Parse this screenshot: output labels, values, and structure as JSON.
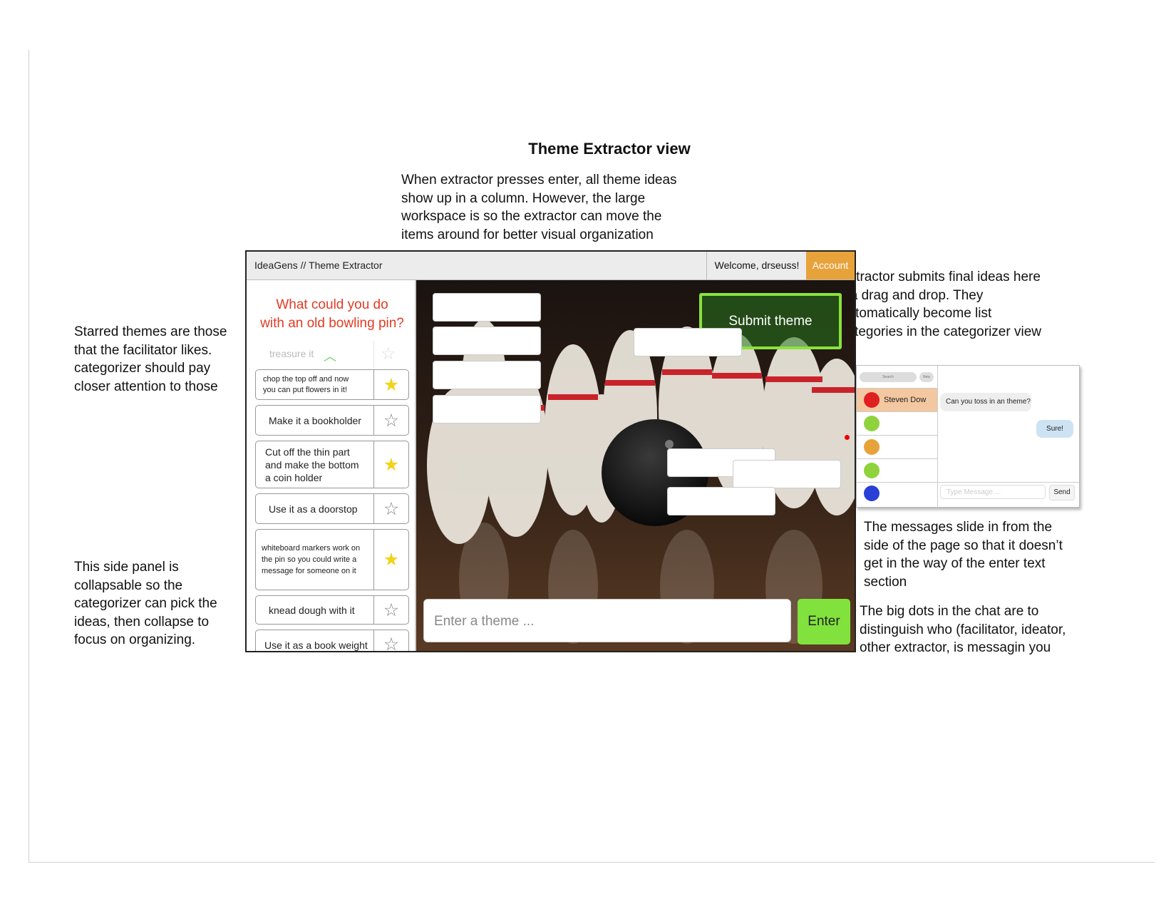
{
  "page": {
    "title": "Theme Extractor view",
    "notes": {
      "top": "When extractor presses enter, all theme ideas\nshow up in a column. However, the large\nworkspace is so the extractor can move the\nitems around for better visual organization",
      "starred": "Starred themes are those\nthat the facilitator likes.\ncategorizer should pay\ncloser attention to those",
      "side_panel": "This side panel is\ncollapsable so the\ncategorizer can pick the\nideas, then collapse to\nfocus on organizing.",
      "submit": "Extractor submits final ideas here\nvia drag and drop. They\nautomatically become list\ncategories in the categorizer view",
      "messages": "The messages slide in from the\nside of the page so that it doesn’t\nget in the way of the enter text\nsection",
      "dots": "The big dots in the chat are to\ndistinguish who (facilitator, ideator,\nother extractor, is messagin you"
    }
  },
  "app": {
    "title": "IdeaGens // Theme Extractor",
    "welcome": "Welcome, drseuss!",
    "account_label": "Account",
    "accent_color": "#e8a23a"
  },
  "sidebar": {
    "prompt": "What could you do\nwith an old bowling pin?",
    "ghost_item": "treasure it",
    "ideas": [
      {
        "text": "chop the top off and now\nyou can put flowers in it!",
        "starred": true
      },
      {
        "text": "Make it a bookholder",
        "starred": false
      },
      {
        "text": "Cut off the thin part\nand make the bottom\na coin holder",
        "starred": true
      },
      {
        "text": "Use it as a doorstop",
        "starred": false
      },
      {
        "text": "whiteboard markers work on\nthe pin so you could write a\nmessage for someone on it",
        "starred": true
      },
      {
        "text": "knead dough with it",
        "starred": false
      },
      {
        "text": "Use it as a book weight",
        "starred": false
      }
    ]
  },
  "workspace": {
    "submit_label": "Submit theme",
    "input_placeholder": "Enter a theme ...",
    "enter_label": "Enter",
    "submit_border_color": "#8ae23c"
  },
  "chat": {
    "search_label": "Search",
    "new_label": "New",
    "contacts": [
      {
        "name": "Steven Dow",
        "color": "#e02020"
      },
      {
        "name": "",
        "color": "#8fd33c"
      },
      {
        "name": "",
        "color": "#e8a23a"
      },
      {
        "name": "",
        "color": "#8fd33c"
      },
      {
        "name": "",
        "color": "#2a3fd6"
      }
    ],
    "incoming_message": "Can you toss in an theme?",
    "outgoing_message": "Sure!",
    "message_placeholder": "Type Message ...",
    "send_label": "Send"
  }
}
